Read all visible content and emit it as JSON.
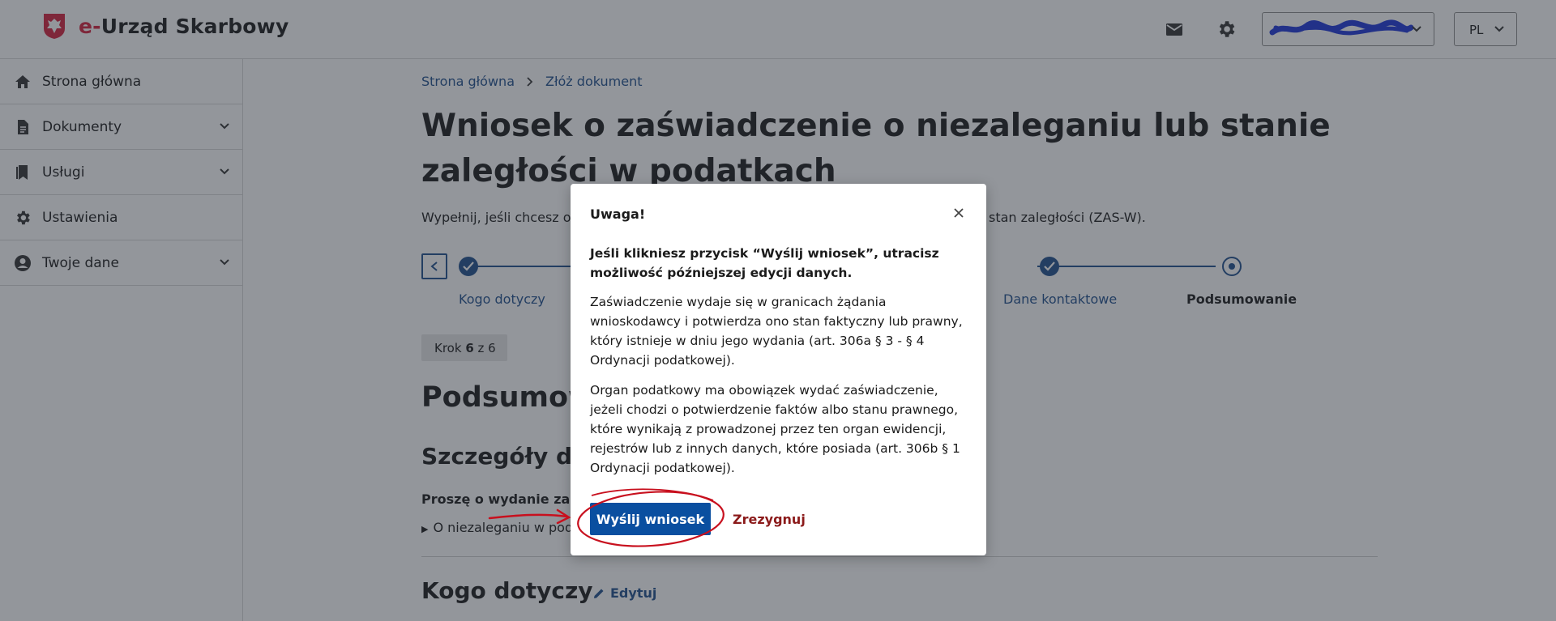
{
  "header": {
    "brand_prefix": "e-",
    "brand_name": "Urząd Skarbowy",
    "lang": "PL",
    "icons": [
      "mail-icon",
      "gear-icon",
      "chevron-down-icon"
    ]
  },
  "sidebar": {
    "items": [
      {
        "label": "Strona główna",
        "icon": "home-icon"
      },
      {
        "label": "Dokumenty",
        "icon": "document-icon"
      },
      {
        "label": "Usługi",
        "icon": "bookmark-icon"
      },
      {
        "label": "Ustawienia",
        "icon": "gear-icon"
      },
      {
        "label": "Twoje dane",
        "icon": "user-icon"
      }
    ]
  },
  "breadcrumb": {
    "home": "Strona główna",
    "current": "Złóż dokument"
  },
  "page": {
    "title": "Wniosek o zaświadczenie o niezaleganiu lub stanie zaległości w podatkach",
    "lead_start": "Wypełnij, jeśli chcesz otr",
    "lead_end": "stan zaległości (ZAS-W).",
    "step_count_prefix": "Krok ",
    "step_current": "6",
    "step_count_suffix": " z 6",
    "summary_heading": "Podsumow",
    "details_heading": "Szczegóły do",
    "ask_text": "Proszę o wydanie zaśw",
    "option_text": "O niezaleganiu w poda",
    "who_heading": "Kogo dotyczy",
    "edit_label": "Edytuj"
  },
  "stepper": {
    "steps": [
      {
        "label": "Kogo dotyczy",
        "state": "done"
      },
      {
        "label": "Dane kontaktowe",
        "state": "done"
      },
      {
        "label": "Podsumowanie",
        "state": "current"
      }
    ]
  },
  "modal": {
    "title": "Uwaga!",
    "warning": "Jeśli klikniesz przycisk “Wyślij wniosek”, utracisz możliwość późniejszej edycji danych.",
    "p1": "Zaświadczenie wydaje się w granicach żądania wnioskodawcy i potwierdza ono stan faktyczny lub prawny, który istnieje w dniu jego wydania (art. 306a § 3 - § 4 Ordynacji podatkowej).",
    "p2": "Organ podatkowy ma obowiązek wydać zaświadczenie, jeżeli chodzi o potwierdzenie faktów albo stanu prawnego, które wynikają z prowadzonej przez ten organ ewidencji, rejestrów lub z innych danych, które posiada (art. 306b § 1 Ordynacji podatkowej).",
    "send_label": "Wyślij wniosek",
    "cancel_label": "Zrezygnuj"
  },
  "colors": {
    "primary": "#1f4e8c",
    "button": "#0a4fa0",
    "cancel": "#8b1a1a",
    "brand_red": "#d4213d",
    "annotation": "#c8101e"
  }
}
